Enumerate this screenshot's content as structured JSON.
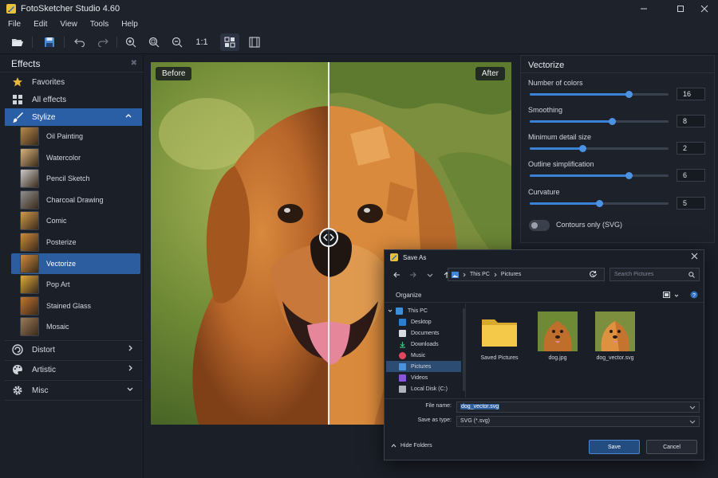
{
  "app": {
    "title": "FotoSketcher Studio 4.60"
  },
  "menu": [
    "File",
    "Edit",
    "View",
    "Tools",
    "Help"
  ],
  "toolbar": {
    "zoom_label": "1:1"
  },
  "effects_panel": {
    "title": "Effects",
    "favorites": "Favorites",
    "all_effects": "All effects",
    "stylize": "Stylize",
    "items": [
      "Oil Painting",
      "Watercolor",
      "Pencil Sketch",
      "Charcoal Drawing",
      "Comic",
      "Posterize",
      "Vectorize",
      "Pop Art",
      "Stained Glass",
      "Mosaic"
    ],
    "selected": "Vectorize",
    "distort": "Distort",
    "artistic": "Artistic",
    "misc": "Misc"
  },
  "canvas": {
    "before_label": "Before",
    "after_label": "After"
  },
  "vectorize": {
    "title": "Vectorize",
    "params": [
      {
        "label": "Number of colors",
        "value": "16",
        "level": 0.71
      },
      {
        "label": "Smoothing",
        "value": "8",
        "level": 0.59
      },
      {
        "label": "Minimum detail size",
        "value": "2",
        "level": 0.38
      },
      {
        "label": "Outline simplification",
        "value": "6",
        "level": 0.71
      },
      {
        "label": "Curvature",
        "value": "5",
        "level": 0.5
      }
    ],
    "toggle_label": "Contours only (SVG)"
  },
  "save_dialog": {
    "title": "Save As",
    "breadcrumb": [
      "This PC",
      "Pictures"
    ],
    "search_placeholder": "Search Pictures",
    "organize": "Organize",
    "tree": [
      "This PC",
      "Desktop",
      "Documents",
      "Downloads",
      "Music",
      "Pictures",
      "Videos",
      "Local Disk (C:)"
    ],
    "tree_selected": "Pictures",
    "files": [
      "Saved Pictures",
      "dog.jpg",
      "dog_vector.svg"
    ],
    "file_name_label": "File name:",
    "file_name_value": "dog_vector.svg",
    "save_type_label": "Save as type:",
    "save_type_value": "SVG (*.svg)",
    "hide_folders": "Hide Folders",
    "save": "Save",
    "cancel": "Cancel"
  }
}
